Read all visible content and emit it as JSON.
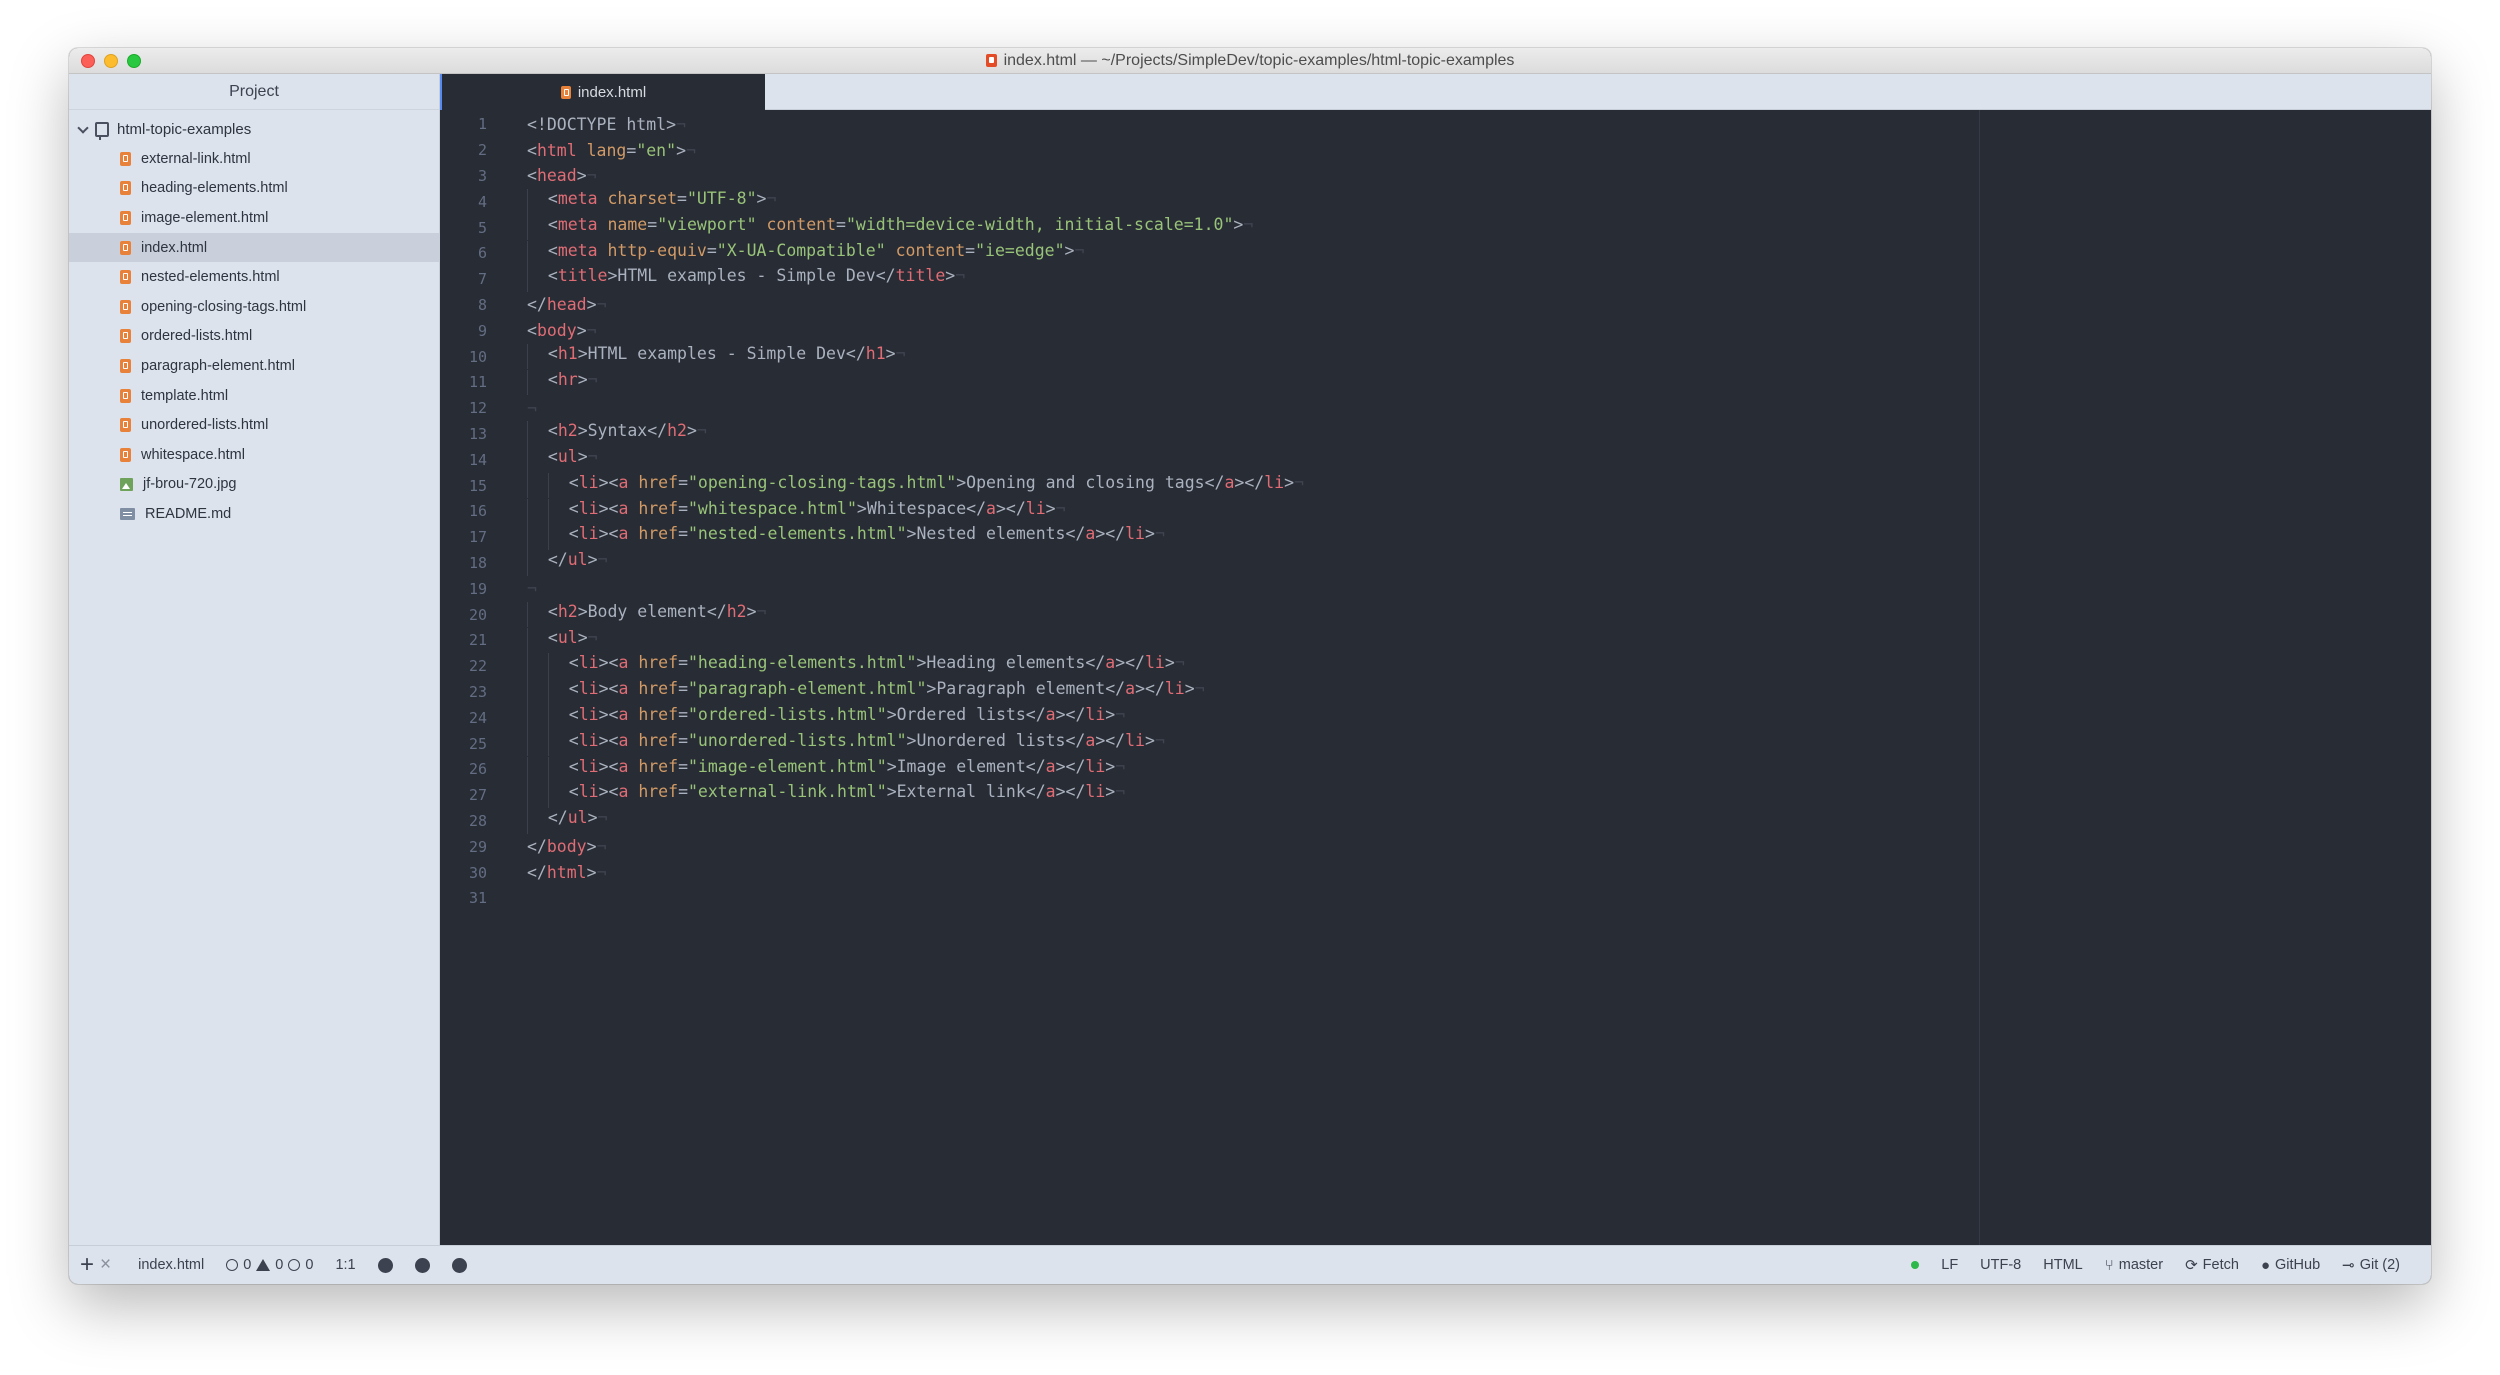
{
  "window": {
    "title": "index.html — ~/Projects/SimpleDev/topic-examples/html-topic-examples"
  },
  "sidebar": {
    "header": "Project",
    "root": "html-topic-examples",
    "files": [
      {
        "name": "external-link.html",
        "type": "html",
        "selected": false
      },
      {
        "name": "heading-elements.html",
        "type": "html",
        "selected": false
      },
      {
        "name": "image-element.html",
        "type": "html",
        "selected": false
      },
      {
        "name": "index.html",
        "type": "html",
        "selected": true
      },
      {
        "name": "nested-elements.html",
        "type": "html",
        "selected": false
      },
      {
        "name": "opening-closing-tags.html",
        "type": "html",
        "selected": false
      },
      {
        "name": "ordered-lists.html",
        "type": "html",
        "selected": false
      },
      {
        "name": "paragraph-element.html",
        "type": "html",
        "selected": false
      },
      {
        "name": "template.html",
        "type": "html",
        "selected": false
      },
      {
        "name": "unordered-lists.html",
        "type": "html",
        "selected": false
      },
      {
        "name": "whitespace.html",
        "type": "html",
        "selected": false
      },
      {
        "name": "jf-brou-720.jpg",
        "type": "image",
        "selected": false
      },
      {
        "name": "README.md",
        "type": "markdown",
        "selected": false
      }
    ]
  },
  "tabs": [
    {
      "label": "index.html",
      "active": true
    }
  ],
  "editor": {
    "lines": [
      "<!DOCTYPE html>",
      "<html lang=\"en\">",
      "<head>",
      "  <meta charset=\"UTF-8\">",
      "  <meta name=\"viewport\" content=\"width=device-width, initial-scale=1.0\">",
      "  <meta http-equiv=\"X-UA-Compatible\" content=\"ie=edge\">",
      "  <title>HTML examples - Simple Dev</title>",
      "</head>",
      "<body>",
      "  <h1>HTML examples - Simple Dev</h1>",
      "  <hr>",
      "",
      "  <h2>Syntax</h2>",
      "  <ul>",
      "    <li><a href=\"opening-closing-tags.html\">Opening and closing tags</a></li>",
      "    <li><a href=\"whitespace.html\">Whitespace</a></li>",
      "    <li><a href=\"nested-elements.html\">Nested elements</a></li>",
      "  </ul>",
      "",
      "  <h2>Body element</h2>",
      "  <ul>",
      "    <li><a href=\"heading-elements.html\">Heading elements</a></li>",
      "    <li><a href=\"paragraph-element.html\">Paragraph element</a></li>",
      "    <li><a href=\"ordered-lists.html\">Ordered lists</a></li>",
      "    <li><a href=\"unordered-lists.html\">Unordered lists</a></li>",
      "    <li><a href=\"image-element.html\">Image element</a></li>",
      "    <li><a href=\"external-link.html\">External link</a></li>",
      "  </ul>",
      "</body>",
      "</html>",
      ""
    ]
  },
  "statusbar": {
    "file": "index.html",
    "errors": "0",
    "warnings": "0",
    "infos": "0",
    "cursor": "1:1",
    "line_ending": "LF",
    "encoding": "UTF-8",
    "grammar": "HTML",
    "branch": "master",
    "fetch": "Fetch",
    "github": "GitHub",
    "git": "Git (2)"
  },
  "colors": {
    "editor_bg": "#282c34",
    "sidebar_bg": "#dde3ec",
    "tag": "#e06c75",
    "attribute": "#d19a66",
    "string": "#98c379",
    "html_icon": "#e8823a"
  }
}
